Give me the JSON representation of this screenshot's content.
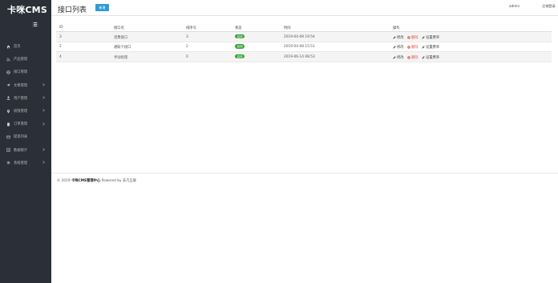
{
  "sidebar": {
    "brand": "卡咪CMS",
    "toggle_icon": "hamburger-icon",
    "items": [
      {
        "label": "首页",
        "icon": "home-icon",
        "has_arrow": false
      },
      {
        "label": "产品管理",
        "icon": "rss-icon",
        "has_arrow": false
      },
      {
        "label": "接口管理",
        "icon": "globe-icon",
        "has_arrow": false
      },
      {
        "label": "文章管理",
        "icon": "send-icon",
        "has_arrow": true
      },
      {
        "label": "用户管理",
        "icon": "user-icon",
        "has_arrow": true
      },
      {
        "label": "权限管理",
        "icon": "pin-icon",
        "has_arrow": true
      },
      {
        "label": "订单管理",
        "icon": "clipboard-icon",
        "has_arrow": true
      },
      {
        "label": "提现列表",
        "icon": "card-icon",
        "has_arrow": false
      },
      {
        "label": "数据统计",
        "icon": "chart-icon",
        "has_arrow": true
      },
      {
        "label": "系统管理",
        "icon": "gear-icon",
        "has_arrow": true
      }
    ]
  },
  "header": {
    "title": "接口列表",
    "add_button": "新增",
    "user": "admin",
    "logout": "注销登录"
  },
  "table": {
    "columns": [
      "ID",
      "接口名",
      "排序号",
      "状态",
      "时间",
      "操作"
    ],
    "rows": [
      {
        "id": "3",
        "name": "话费接口",
        "sort": "3",
        "status": "启用",
        "time": "2019-04-08 19:54",
        "edit": "修改",
        "delete": "删除",
        "rate": "设置费率"
      },
      {
        "id": "2",
        "name": "通联卡接口",
        "sort": "2",
        "status": "启用",
        "time": "2019-04-08 15:51",
        "edit": "修改",
        "delete": "删除",
        "rate": "设置费率"
      },
      {
        "id": "4",
        "name": "手动处理",
        "sort": "0",
        "status": "启用",
        "time": "2019-06-14 08:53",
        "edit": "修改",
        "delete": "删除",
        "rate": "设置费率"
      }
    ]
  },
  "footer": {
    "prefix": "© 2019 ",
    "site": "卡咪CMS管理中心",
    "powered": " Powered by ",
    "company": "非凡互联"
  },
  "colors": {
    "sidebar_bg": "#2b2f37",
    "accent": "#2d9bd7",
    "status_green": "#3aa43a",
    "danger": "#d9534f"
  }
}
